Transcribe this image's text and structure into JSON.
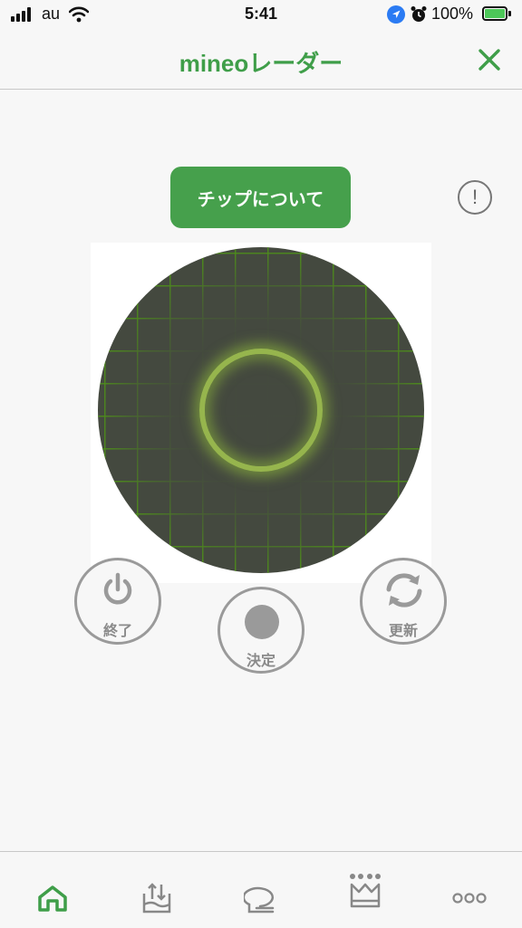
{
  "status_bar": {
    "carrier": "au",
    "time": "5:41",
    "battery_percent": "100%"
  },
  "header": {
    "title": "mineoレーダー"
  },
  "tip_button": {
    "label": "チップについて"
  },
  "info_icon": "!",
  "controls": {
    "end_label": "終了",
    "confirm_label": "決定",
    "refresh_label": "更新"
  },
  "tab_bar": {
    "tabs": [
      "home-icon",
      "data-transfer-icon",
      "chat-icon",
      "crown-icon",
      "more-icon"
    ],
    "active_index": 0
  },
  "colors": {
    "accent": "#3f9e49",
    "button_green": "#46a04c",
    "radar_bg": "#44493f",
    "radar_grid": "#4d8c1b",
    "radar_ring": "#a5c850",
    "control_gray": "#9a9a9a"
  }
}
